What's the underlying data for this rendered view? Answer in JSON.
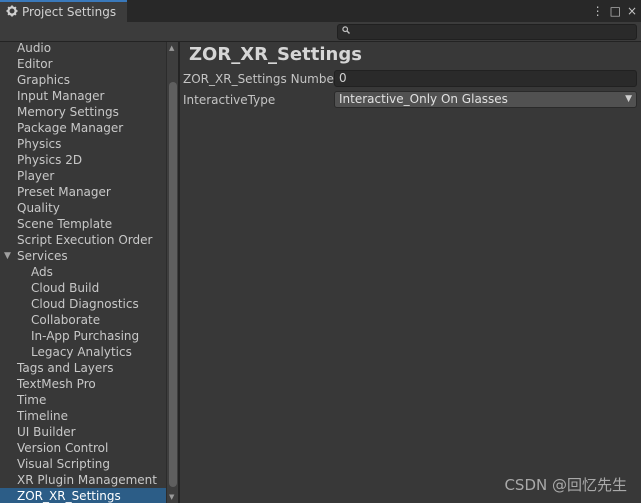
{
  "window": {
    "tab_title": "Project Settings",
    "tab_icon": "gear-icon",
    "controls": [
      "more-icon",
      "maximize-icon",
      "close-icon"
    ],
    "control_glyphs": [
      "⋮",
      "□",
      "×"
    ]
  },
  "search": {
    "placeholder": "",
    "icon": "search-icon",
    "glyph": "🔍"
  },
  "sidebar": {
    "items": [
      {
        "label": "Audio",
        "level": 0
      },
      {
        "label": "Editor",
        "level": 0
      },
      {
        "label": "Graphics",
        "level": 0
      },
      {
        "label": "Input Manager",
        "level": 0
      },
      {
        "label": "Memory Settings",
        "level": 0
      },
      {
        "label": "Package Manager",
        "level": 0
      },
      {
        "label": "Physics",
        "level": 0
      },
      {
        "label": "Physics 2D",
        "level": 0
      },
      {
        "label": "Player",
        "level": 0
      },
      {
        "label": "Preset Manager",
        "level": 0
      },
      {
        "label": "Quality",
        "level": 0
      },
      {
        "label": "Scene Template",
        "level": 0
      },
      {
        "label": "Script Execution Order",
        "level": 0
      },
      {
        "label": "Services",
        "level": 0,
        "expanded": true
      },
      {
        "label": "Ads",
        "level": 1
      },
      {
        "label": "Cloud Build",
        "level": 1
      },
      {
        "label": "Cloud Diagnostics",
        "level": 1
      },
      {
        "label": "Collaborate",
        "level": 1
      },
      {
        "label": "In-App Purchasing",
        "level": 1
      },
      {
        "label": "Legacy Analytics",
        "level": 1
      },
      {
        "label": "Tags and Layers",
        "level": 0
      },
      {
        "label": "TextMesh Pro",
        "level": 0
      },
      {
        "label": "Time",
        "level": 0
      },
      {
        "label": "Timeline",
        "level": 0
      },
      {
        "label": "UI Builder",
        "level": 0
      },
      {
        "label": "Version Control",
        "level": 0
      },
      {
        "label": "Visual Scripting",
        "level": 0
      },
      {
        "label": "XR Plugin Management",
        "level": 0
      },
      {
        "label": "ZOR_XR_Settings",
        "level": 0,
        "selected": true
      }
    ],
    "fold_glyph": "▼"
  },
  "scrollbar": {
    "up_glyph": "▲",
    "down_glyph": "▼"
  },
  "main": {
    "title": "ZOR_XR_Settings",
    "fields": {
      "number_label": "ZOR_XR_Settings Number",
      "number_value": "0",
      "type_label": "InteractiveType",
      "type_value": "Interactive_Only On Glasses",
      "dropdown_arrow": "▼"
    }
  },
  "watermark": "CSDN @回忆先生",
  "colors": {
    "selection": "#2c5d87",
    "tab_accent": "#3a79bb",
    "background": "#383838"
  }
}
